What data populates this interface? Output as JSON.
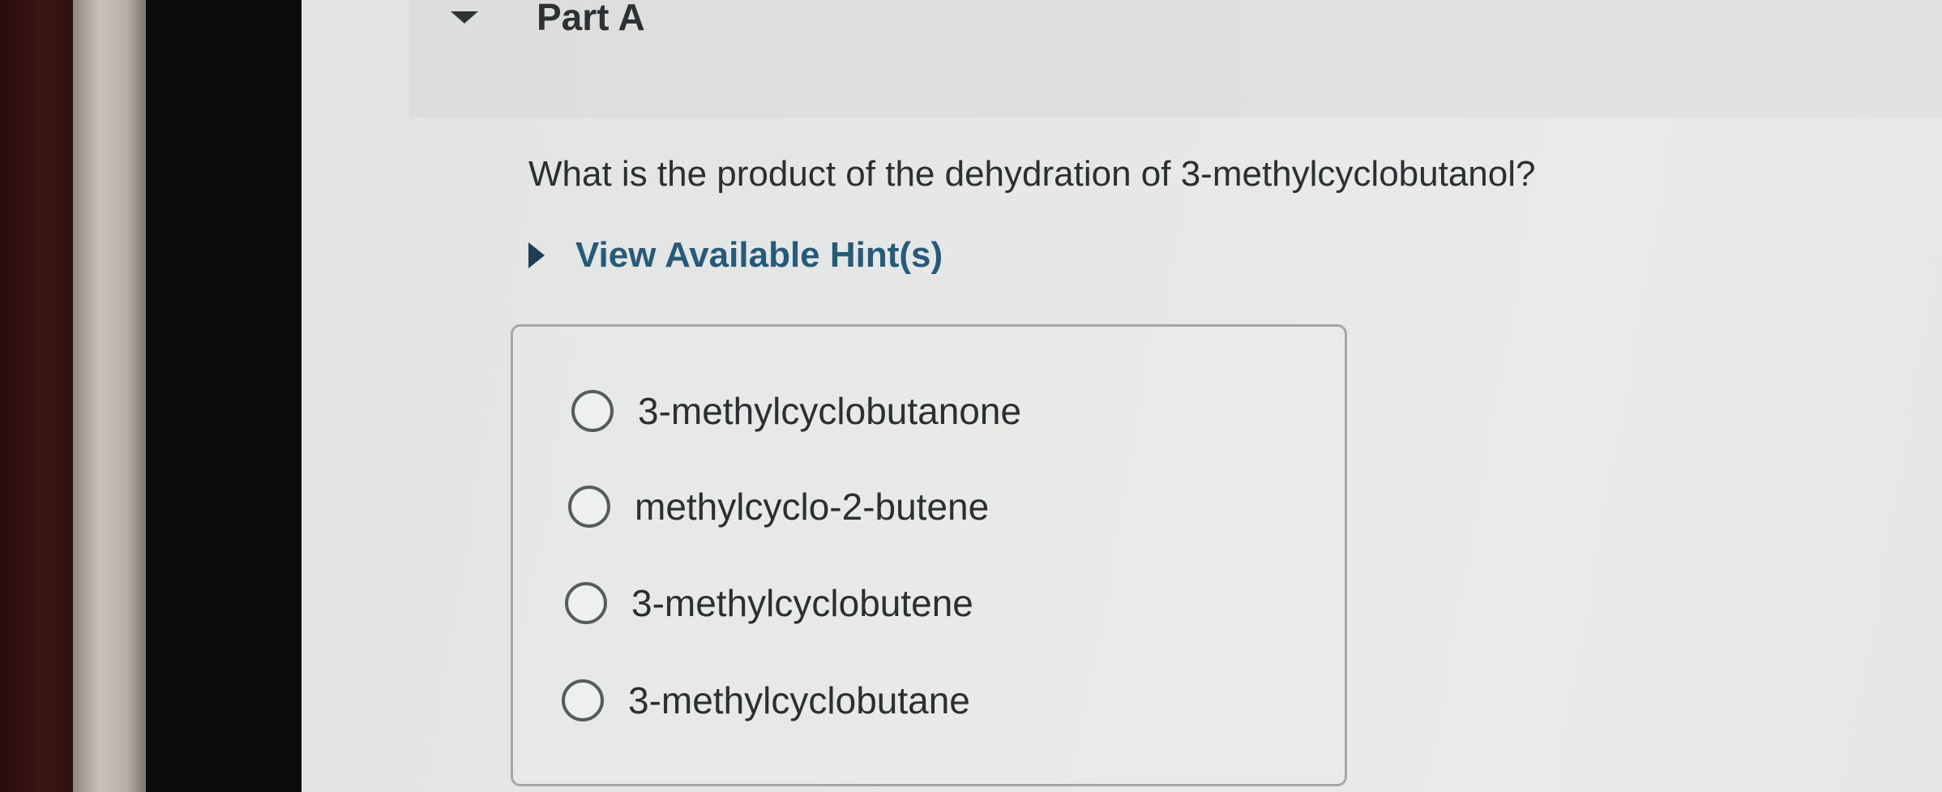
{
  "part": {
    "title": "Part A"
  },
  "question": {
    "text": "What is the product of the dehydration of 3-methylcyclobutanol?"
  },
  "hints": {
    "label": "View Available Hint(s)"
  },
  "options": [
    {
      "label": "3-methylcyclobutanone",
      "selected": false
    },
    {
      "label": "methylcyclo-2-butene",
      "selected": false
    },
    {
      "label": "3-methylcyclobutene",
      "selected": false
    },
    {
      "label": "3-methylcyclobutane",
      "selected": false
    }
  ],
  "colors": {
    "hint_link": "#255a79",
    "text": "#2b2f31",
    "background": "#e4e6e5"
  }
}
